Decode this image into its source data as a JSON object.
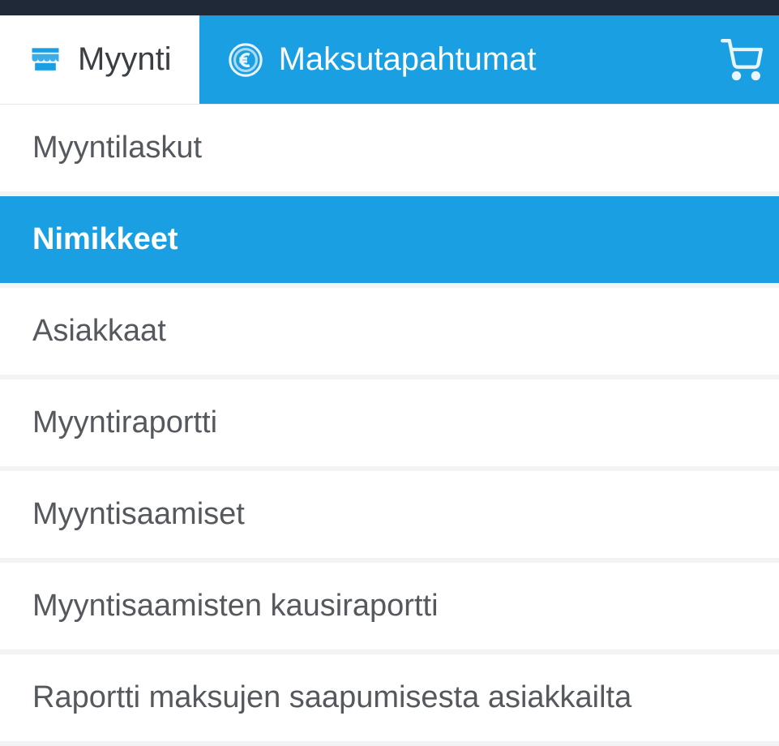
{
  "tabs": {
    "sales": {
      "label": "Myynti"
    },
    "transactions": {
      "label": "Maksutapahtumat"
    }
  },
  "menu": {
    "items": [
      {
        "label": "Myyntilaskut",
        "selected": false
      },
      {
        "label": "Nimikkeet",
        "selected": true
      },
      {
        "label": "Asiakkaat",
        "selected": false
      },
      {
        "label": "Myyntiraportti",
        "selected": false
      },
      {
        "label": "Myyntisaamiset",
        "selected": false
      },
      {
        "label": "Myyntisaamisten kausiraportti",
        "selected": false
      },
      {
        "label": "Raportti maksujen saapumisesta asiakkailta",
        "selected": false
      }
    ]
  },
  "colors": {
    "accent": "#1b9fe3",
    "text": "#55595e",
    "divider": "#f2f3f4"
  }
}
